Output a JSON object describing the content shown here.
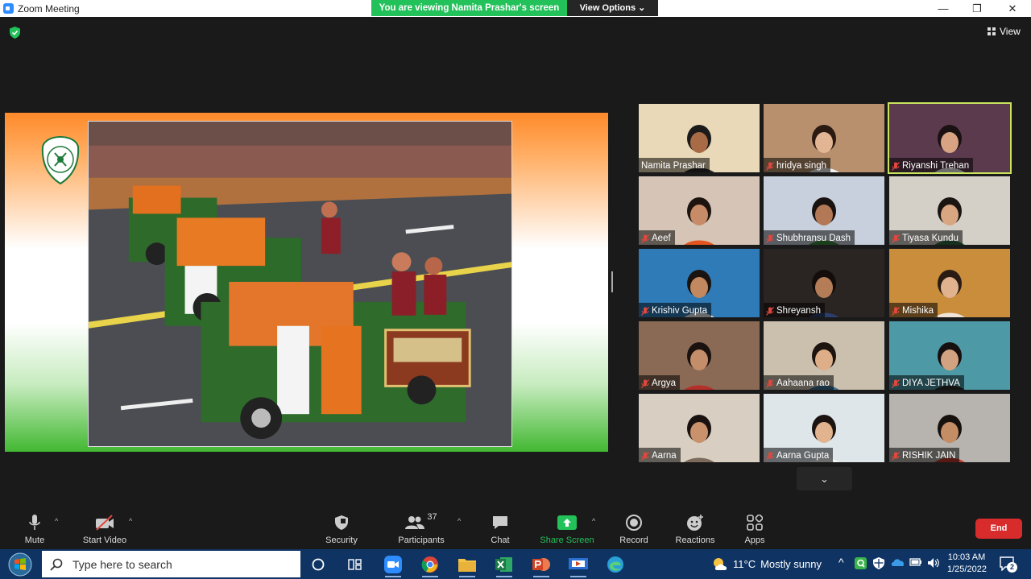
{
  "window": {
    "title": "Zoom Meeting",
    "controls": {
      "minimize": "—",
      "restore": "❐",
      "close": "✕"
    }
  },
  "share": {
    "banner": "You are viewing Namita Prashar's screen",
    "view_options": "View Options"
  },
  "header": {
    "view_label": "View"
  },
  "gallery": {
    "participants": [
      {
        "name": "Namita Prashar",
        "muted": false,
        "bg": "#e9d9b8",
        "skin": "#a86b45",
        "shirt": "#2b2b2b",
        "hair": "#1b1b1b"
      },
      {
        "name": "hridya singh",
        "muted": true,
        "bg": "#b8906e",
        "skin": "#e2b594",
        "shirt": "#f0f0f0",
        "hair": "#2a1a12"
      },
      {
        "name": "Riyanshi Trehan",
        "muted": true,
        "bg": "#5b3a4e",
        "skin": "#d7a383",
        "shirt": "#f2f2f2",
        "hair": "#1a1212",
        "active": true
      },
      {
        "name": "Aeef",
        "muted": true,
        "bg": "#d6c5b7",
        "skin": "#c78c67",
        "shirt": "#e2551f",
        "hair": "#1d1410"
      },
      {
        "name": "Shubhransu Dash",
        "muted": true,
        "bg": "#c7d0dc",
        "skin": "#b37855",
        "shirt": "#3d8b3d",
        "hair": "#1a1210"
      },
      {
        "name": "Tiyasa Kundu",
        "muted": true,
        "bg": "#d4d0c8",
        "skin": "#d8a680",
        "shirt": "#2f6b3f",
        "hair": "#1b1512"
      },
      {
        "name": "Krishiv Gupta",
        "muted": true,
        "bg": "#2e7bb8",
        "skin": "#c2885f",
        "shirt": "#e8e8e8",
        "hair": "#1a1410"
      },
      {
        "name": "Shreyansh",
        "muted": true,
        "bg": "#2a2522",
        "skin": "#b57c58",
        "shirt": "#2c3e6b",
        "hair": "#120d0b"
      },
      {
        "name": "Mishika",
        "muted": true,
        "bg": "#c98d3c",
        "skin": "#e0b28e",
        "shirt": "#f0e4d8",
        "hair": "#2a1c14"
      },
      {
        "name": "Argya",
        "muted": true,
        "bg": "#8a6a55",
        "skin": "#c58e6a",
        "shirt": "#b5302a",
        "hair": "#1a120f"
      },
      {
        "name": "Aahaana rao",
        "muted": true,
        "bg": "#cbbfae",
        "skin": "#ddae88",
        "shirt": "#3c6f93",
        "hair": "#1d1410"
      },
      {
        "name": "DIYA JETHVA",
        "muted": true,
        "bg": "#4d9aa6",
        "skin": "#d3a381",
        "shirt": "#2b2b2b",
        "hair": "#161010"
      },
      {
        "name": "Aarna",
        "muted": true,
        "bg": "#d8cfc2",
        "skin": "#c9926c",
        "shirt": "#7d6b5d",
        "hair": "#1a1210"
      },
      {
        "name": "Aarna Gupta",
        "muted": true,
        "bg": "#dfe6ea",
        "skin": "#e1b38f",
        "shirt": "#f4f4f4",
        "hair": "#1c1411"
      },
      {
        "name": "RISHIK JAIN",
        "muted": true,
        "bg": "#b7b3ae",
        "skin": "#c58d66",
        "shirt": "#c0392b",
        "hair": "#17110e"
      }
    ],
    "scroll_label": "⌄"
  },
  "toolbar": {
    "mute": "Mute",
    "start_video": "Start Video",
    "security": "Security",
    "participants": "Participants",
    "participants_count": "37",
    "chat": "Chat",
    "share_screen": "Share Screen",
    "record": "Record",
    "reactions": "Reactions",
    "apps": "Apps",
    "end": "End",
    "caret": "^"
  },
  "taskbar": {
    "search_placeholder": "Type here to search",
    "weather_temp": "11°C",
    "weather_desc": "Mostly sunny",
    "time": "10:03 AM",
    "date": "1/25/2022",
    "notification_count": "2",
    "tray_chevron": "^",
    "colors": {
      "zoom": "#2d8cff",
      "chrome": "#f2b51a",
      "explorer": "#f6c343",
      "excel": "#1d7a45",
      "powerpoint": "#d04423",
      "edge": "#2aa0d8"
    }
  },
  "colors": {
    "accent_green": "#23c15a",
    "active_speaker": "#c9e35c",
    "end_red": "#d82c2c",
    "muted_red": "#e0483e"
  }
}
